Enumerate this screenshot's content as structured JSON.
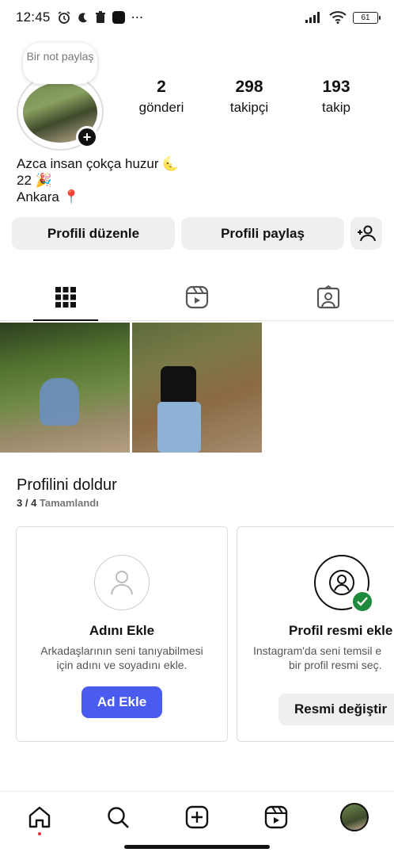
{
  "status": {
    "time": "12:45",
    "battery": "61"
  },
  "profile": {
    "note": "Bir not paylaş",
    "stats": [
      {
        "value": "2",
        "label": "gönderi"
      },
      {
        "value": "298",
        "label": "takipçi"
      },
      {
        "value": "193",
        "label": "takip"
      }
    ],
    "bio_lines": [
      "Azca insan çokça huzur 🌜",
      "22 🎉",
      "Ankara 📍"
    ]
  },
  "buttons": {
    "edit": "Profili düzenle",
    "share": "Profili paylaş"
  },
  "complete_profile": {
    "title": "Profilini doldur",
    "progress": "3 / 4",
    "progress_label": "Tamamlandı",
    "cards": [
      {
        "title": "Adını Ekle",
        "desc": "Arkadaşlarının seni tanıyabilmesi için adını ve soyadını ekle.",
        "button": "Ad Ekle"
      },
      {
        "title": "Profil resmi ekle",
        "desc_line1": "Instagram'da seni temsil e",
        "desc_line2": "bir profil resmi seç.",
        "button": "Resmi değiştir"
      }
    ]
  },
  "colors": {
    "primary_button": "#4a5bf0",
    "check_badge": "#1d8a3c"
  }
}
